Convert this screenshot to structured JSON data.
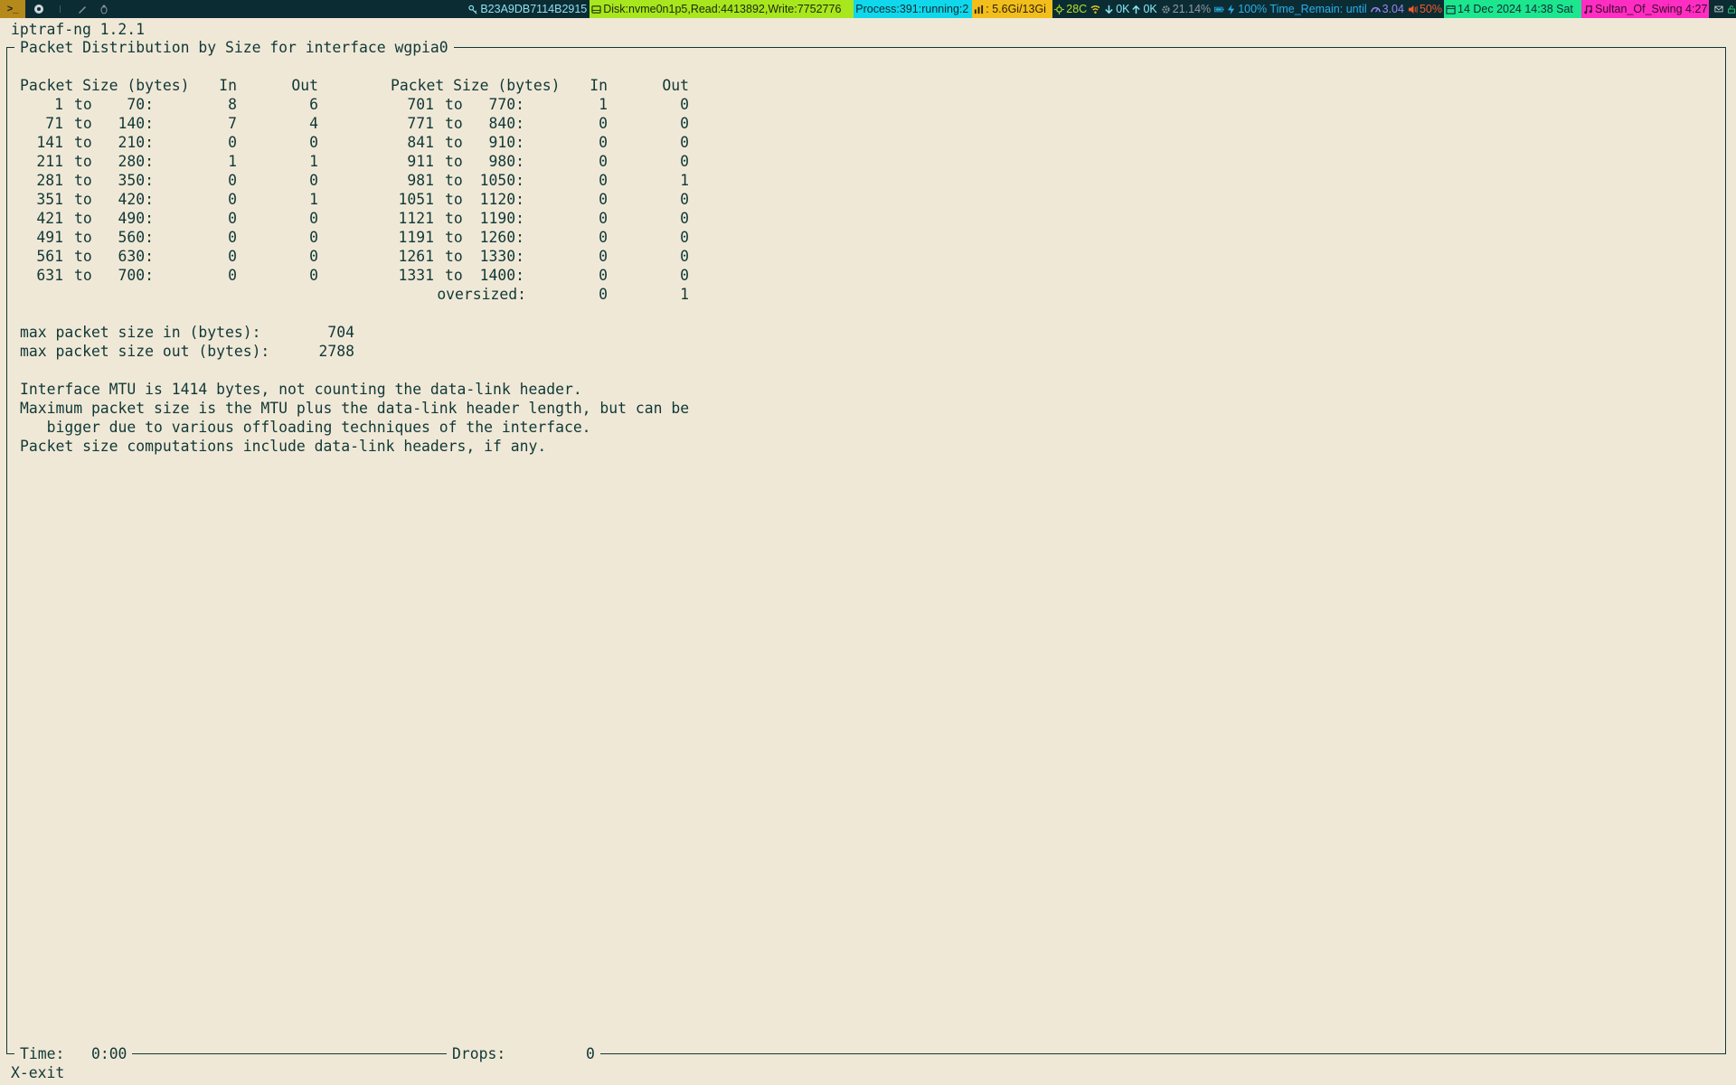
{
  "statusbar": {
    "terminal_icon": ">_",
    "key": "B23A9DB7114B2915",
    "disk": "Disk:nvme0n1p5,Read:4413892,Write:7752776",
    "process": "Process:391:running:2",
    "memory": ": 5.6Gi/13Gi",
    "temperature": "28C",
    "net_down": "0K",
    "net_up": "0K",
    "cpu": "21.14%",
    "battery": "100% Time_Remain: until",
    "load": "3.04",
    "volume": "50%",
    "datetime": "14 Dec 2024 14:38 Sat",
    "music": "Sultan_Of_Swing 4:27"
  },
  "app_title": "iptraf-ng 1.2.1",
  "panel_title": "Packet Distribution by Size for interface wgpia0",
  "table": {
    "headers": {
      "size": "Packet Size (bytes)",
      "in": "In",
      "out": "Out"
    },
    "left_rows": [
      {
        "from": "1",
        "to": "70:",
        "in": "8",
        "out": "6"
      },
      {
        "from": "71",
        "to": "140:",
        "in": "7",
        "out": "4"
      },
      {
        "from": "141",
        "to": "210:",
        "in": "0",
        "out": "0"
      },
      {
        "from": "211",
        "to": "280:",
        "in": "1",
        "out": "1"
      },
      {
        "from": "281",
        "to": "350:",
        "in": "0",
        "out": "0"
      },
      {
        "from": "351",
        "to": "420:",
        "in": "0",
        "out": "1"
      },
      {
        "from": "421",
        "to": "490:",
        "in": "0",
        "out": "0"
      },
      {
        "from": "491",
        "to": "560:",
        "in": "0",
        "out": "0"
      },
      {
        "from": "561",
        "to": "630:",
        "in": "0",
        "out": "0"
      },
      {
        "from": "631",
        "to": "700:",
        "in": "0",
        "out": "0"
      }
    ],
    "right_rows": [
      {
        "from": "701",
        "to": "770:",
        "in": "1",
        "out": "0"
      },
      {
        "from": "771",
        "to": "840:",
        "in": "0",
        "out": "0"
      },
      {
        "from": "841",
        "to": "910:",
        "in": "0",
        "out": "0"
      },
      {
        "from": "911",
        "to": "980:",
        "in": "0",
        "out": "0"
      },
      {
        "from": "981",
        "to": "1050:",
        "in": "0",
        "out": "1"
      },
      {
        "from": "1051",
        "to": "1120:",
        "in": "0",
        "out": "0"
      },
      {
        "from": "1121",
        "to": "1190:",
        "in": "0",
        "out": "0"
      },
      {
        "from": "1191",
        "to": "1260:",
        "in": "0",
        "out": "0"
      },
      {
        "from": "1261",
        "to": "1330:",
        "in": "0",
        "out": "0"
      },
      {
        "from": "1331",
        "to": "1400:",
        "in": "0",
        "out": "0"
      }
    ],
    "separator": "to",
    "oversized": {
      "label": "oversized:",
      "in": "0",
      "out": "1"
    }
  },
  "stats": {
    "max_in_label": "max packet size in (bytes):",
    "max_in_value": "704",
    "max_out_label": "max packet size out (bytes):",
    "max_out_value": "2788"
  },
  "notes": [
    "Interface MTU is 1414 bytes, not counting the data-link header.",
    "Maximum packet size is the MTU plus the data-link header length, but can be",
    "   bigger due to various offloading techniques of the interface.",
    "Packet size computations include data-link headers, if any."
  ],
  "footer": {
    "time_label": "Time:",
    "time_value": "0:00",
    "drops_label": "Drops:",
    "drops_value": "0"
  },
  "hint": "X-exit",
  "colors": {
    "background": "#f0e8d6",
    "text": "#0f3838",
    "statusbar": "#0c2c33"
  }
}
